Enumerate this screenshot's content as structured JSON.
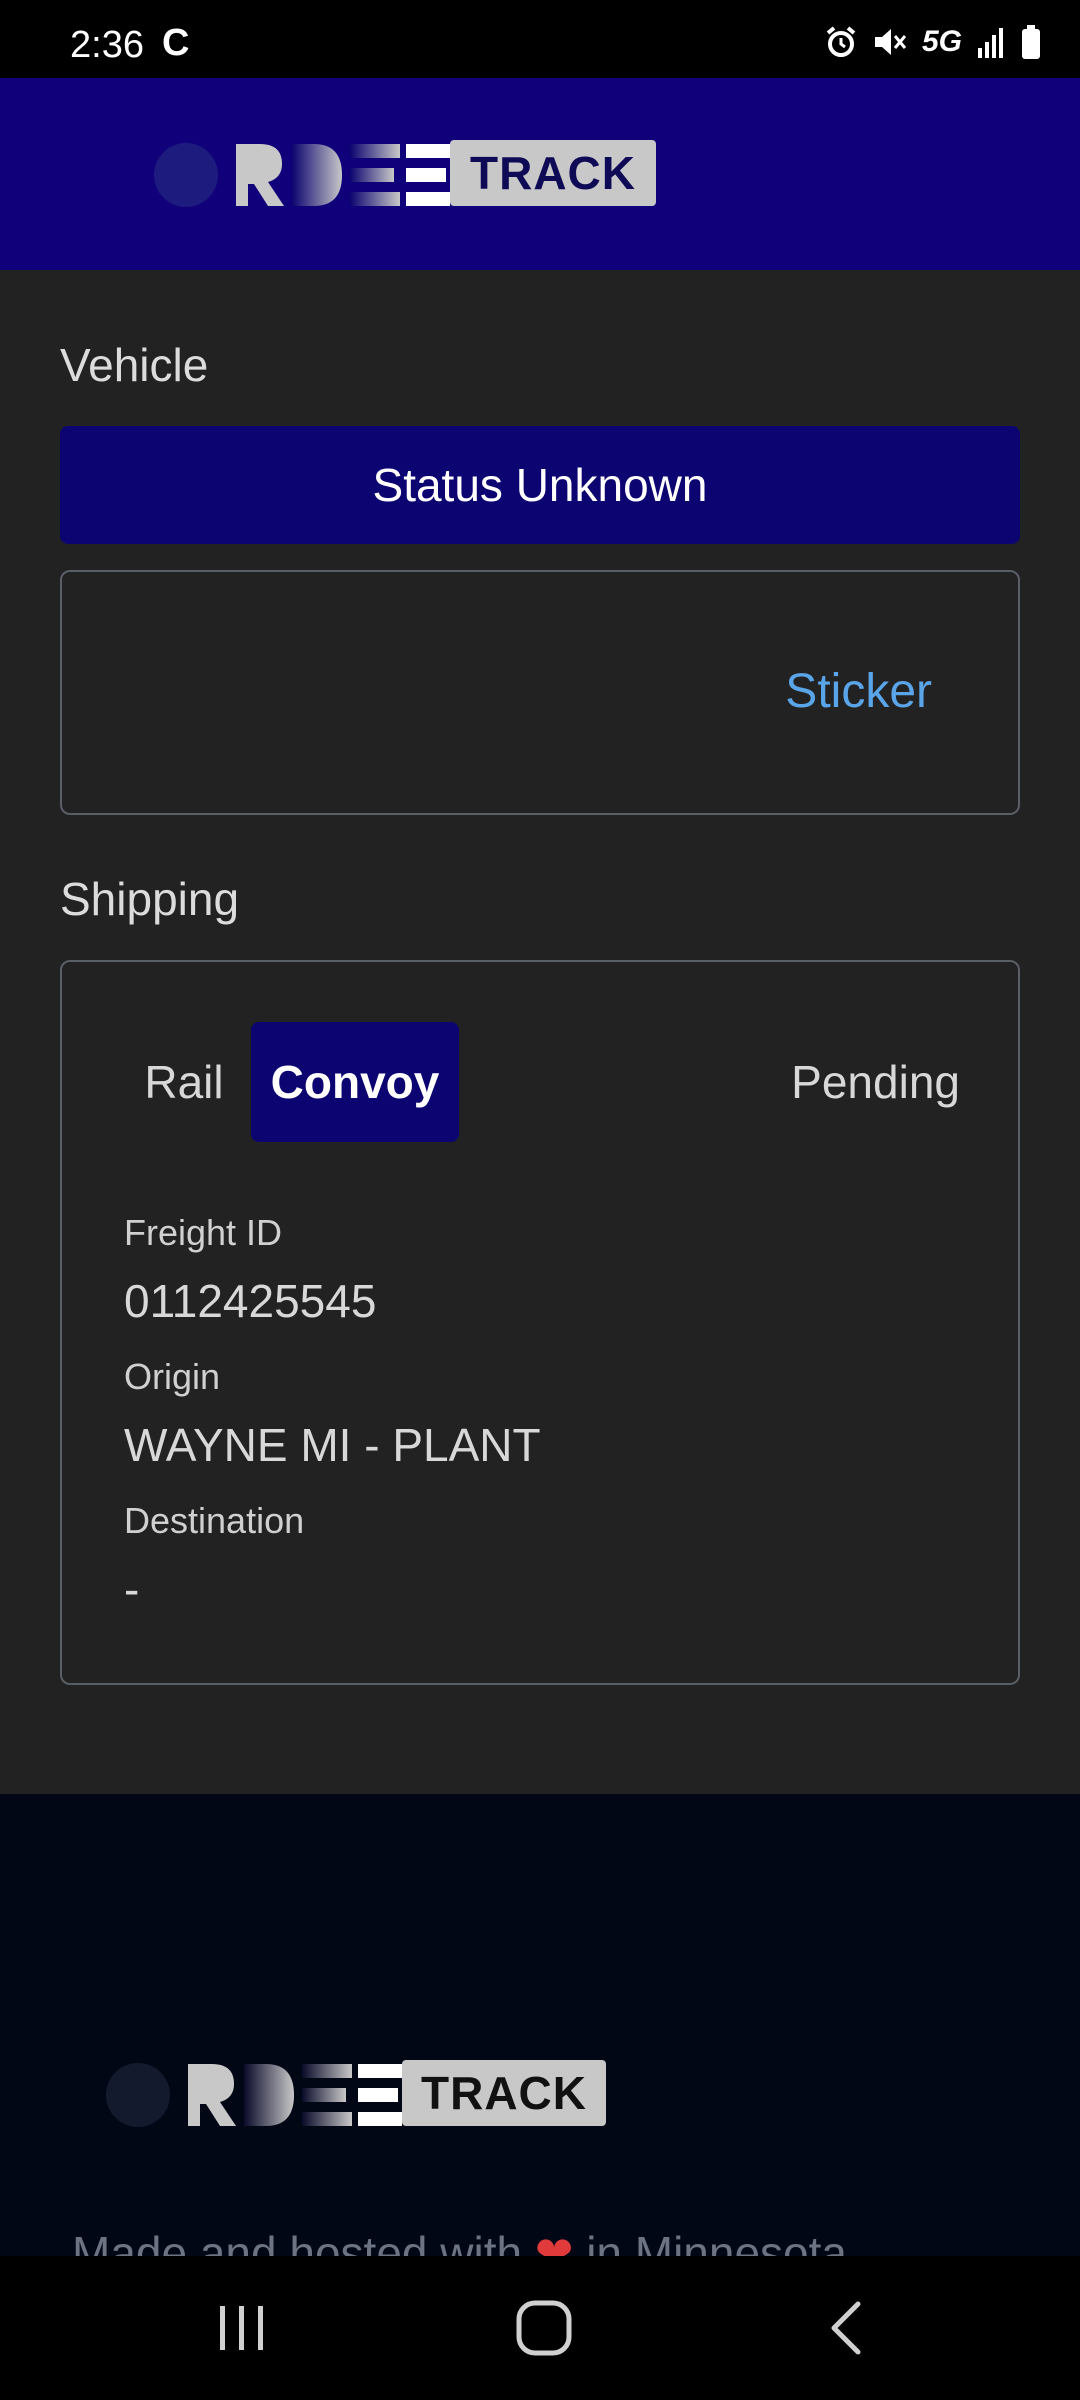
{
  "status_bar": {
    "time": "2:36",
    "app_indicator": "C",
    "network": "5G",
    "icons": [
      "alarm-icon",
      "mute-icon",
      "5g-icon",
      "signal-icon",
      "battery-icon"
    ]
  },
  "header": {
    "logo": {
      "word": "RDER",
      "badge": "TRACK"
    }
  },
  "vehicle": {
    "section_title": "Vehicle",
    "status": "Status Unknown",
    "sticker_link": "Sticker"
  },
  "shipping": {
    "section_title": "Shipping",
    "tabs": [
      {
        "label": "Rail",
        "active": false
      },
      {
        "label": "Convoy",
        "active": true
      }
    ],
    "status": "Pending",
    "fields": [
      {
        "label": "Freight ID",
        "value": "0112425545"
      },
      {
        "label": "Origin",
        "value": "WAYNE MI - PLANT"
      },
      {
        "label": "Destination",
        "value": "-"
      }
    ]
  },
  "footer": {
    "logo": {
      "word": "RDER",
      "badge": "TRACK"
    },
    "text_before": "Made and hosted with",
    "text_after": "in Minnesota"
  },
  "nav_bar": {
    "buttons": [
      "recent-apps-icon",
      "home-icon",
      "back-icon"
    ]
  },
  "colors": {
    "header_bg": "#10007a",
    "accent": "#0c0470",
    "link": "#5aa4e8",
    "page_bg": "#222222",
    "footer_bg": "#020716"
  }
}
